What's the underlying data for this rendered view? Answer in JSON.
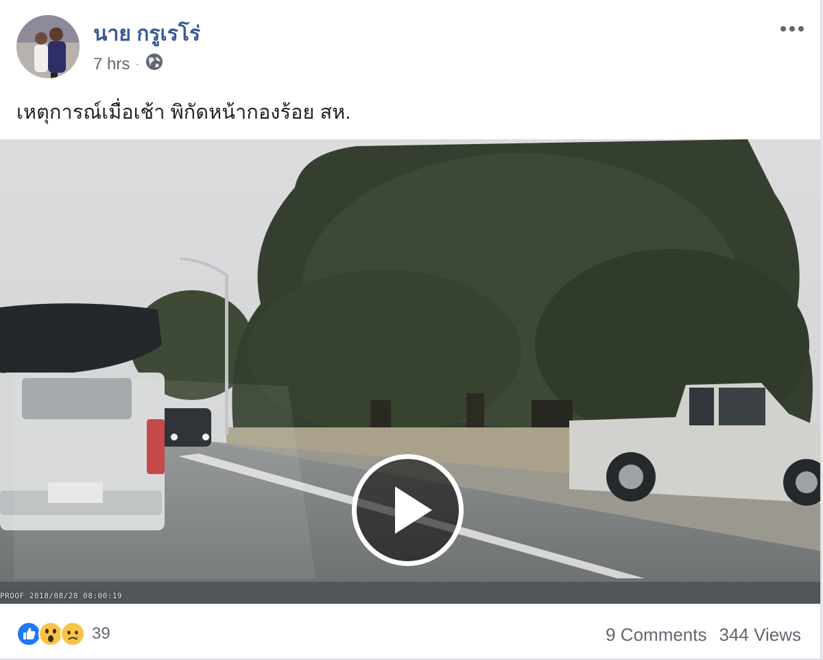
{
  "post": {
    "author": "นาย กรูเรโร่",
    "time": "7 hrs",
    "separator": "·",
    "privacy_icon": "globe-icon",
    "more_icon": "more-options-icon",
    "caption": "เหตุการณ์เมื่อเช้า พิกัดหน้ากองร้อย สห."
  },
  "video": {
    "play_icon": "play-icon",
    "timestamp_overlay": "PROOF 2018/08/28 08:00:19"
  },
  "footer": {
    "reactions": [
      "like-icon",
      "wow-icon",
      "sad-icon"
    ],
    "reaction_count": "39",
    "comments": "9 Comments",
    "views": "344 Views"
  },
  "colors": {
    "author_link": "#385898",
    "meta_text": "#616770",
    "like_blue": "#2078f4",
    "reaction_yellow": "#f7c447"
  }
}
